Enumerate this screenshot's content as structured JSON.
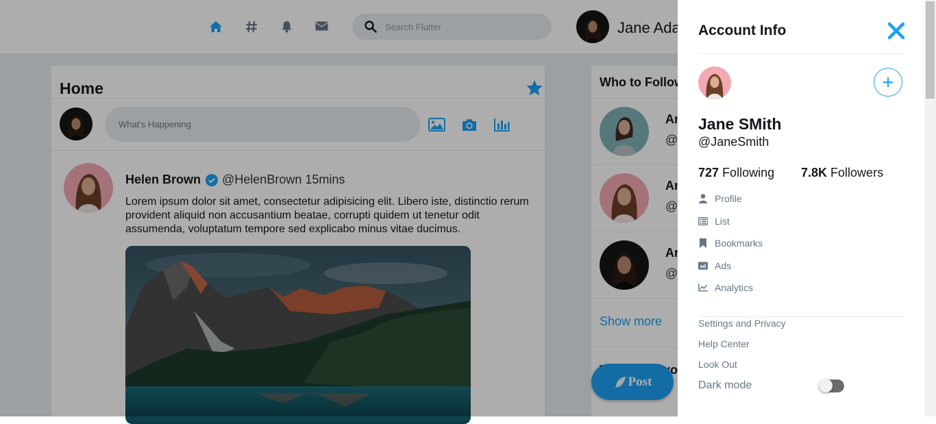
{
  "colors": {
    "accent": "#1da1f2",
    "text": "#14171a",
    "muted": "#657786",
    "page_bg": "#e6ecf0"
  },
  "topnav": {
    "icons": [
      "home-icon",
      "hashtag-icon",
      "bell-icon",
      "envelope-icon"
    ],
    "search_placeholder": "Search Flutter",
    "username": "Jane Ada"
  },
  "feed": {
    "title": "Home",
    "compose_placeholder": "What's Happening",
    "compose_icons": [
      "image-icon",
      "camera-icon",
      "poll-icon"
    ],
    "post": {
      "author": "Helen Brown",
      "handle": "@HelenBrown",
      "time": "15mins",
      "text": "Lorem ipsum dolor sit amet, consectetur adipisicing elit. Libero iste, distinctio rerum provident aliquid non accusantium beatae, corrupti quidem ut tenetur odit assumenda, voluptatum tempore sed explicabo minus vitae ducimus."
    }
  },
  "who_to_follow": {
    "title": "Who to Follow",
    "items": [
      {
        "name": "An",
        "handle": "@"
      },
      {
        "name": "An",
        "handle": "@"
      },
      {
        "name": "An",
        "handle": "@"
      }
    ],
    "show_more": "Show more"
  },
  "trends_peek_title": "Trends for you",
  "post_button": "Post",
  "drawer": {
    "title": "Account Info",
    "name": "Jane SMith",
    "handle": "@JaneSmith",
    "following_count": "727",
    "following_label": "Following",
    "followers_count": "7.8K",
    "followers_label": "Followers",
    "menu": [
      {
        "label": "Profile",
        "icon": "user-icon"
      },
      {
        "label": "List",
        "icon": "list-icon"
      },
      {
        "label": "Bookmarks",
        "icon": "bookmark-icon"
      },
      {
        "label": "Ads",
        "icon": "ad-icon"
      },
      {
        "label": "Analytics",
        "icon": "chart-line-icon"
      }
    ],
    "links": [
      "Settings and Privacy",
      "Help Center",
      "Look Out"
    ],
    "dark_mode_label": "Dark mode",
    "dark_mode_on": false
  }
}
